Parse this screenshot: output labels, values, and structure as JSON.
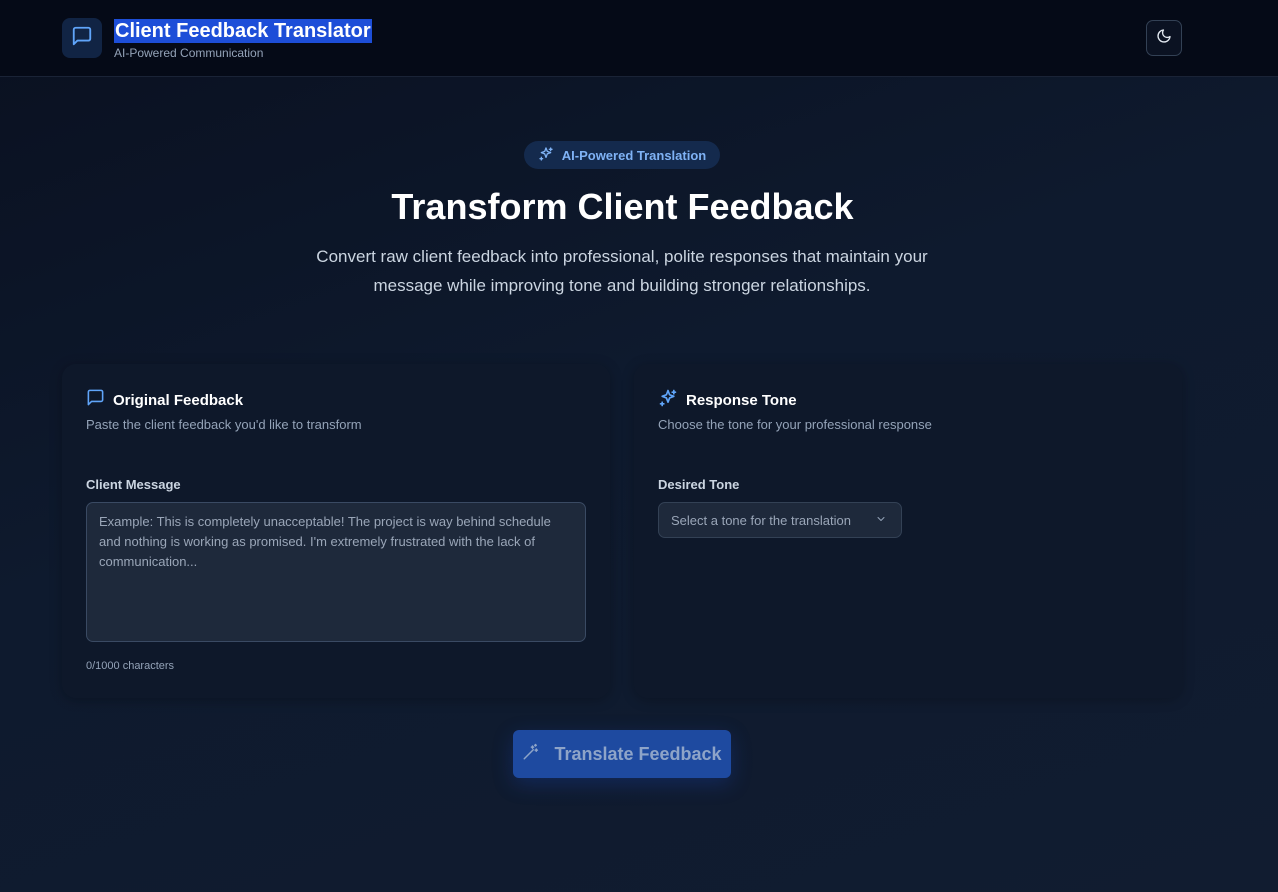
{
  "header": {
    "title": "Client Feedback Translator",
    "subtitle": "AI-Powered Communication",
    "logo_icon": "message-square-icon",
    "theme_icon": "moon-icon"
  },
  "hero": {
    "badge": "AI-Powered Translation",
    "title": "Transform Client Feedback",
    "description": "Convert raw client feedback into professional, polite responses that maintain your message while improving tone and building stronger relationships."
  },
  "original_card": {
    "title": "Original Feedback",
    "description": "Paste the client feedback you'd like to transform",
    "field_label": "Client Message",
    "placeholder": "Example: This is completely unacceptable! The project is way behind schedule and nothing is working as promised. I'm extremely frustrated with the lack of communication...",
    "value": "",
    "counter": "0/1000 characters"
  },
  "tone_card": {
    "title": "Response Tone",
    "description": "Choose the tone for your professional response",
    "field_label": "Desired Tone",
    "select_placeholder": "Select a tone for the translation"
  },
  "actions": {
    "translate_label": "Translate Feedback"
  },
  "colors": {
    "accent": "#3b82f6",
    "button": "#1e4aa0",
    "background": "#0e1a2e"
  }
}
